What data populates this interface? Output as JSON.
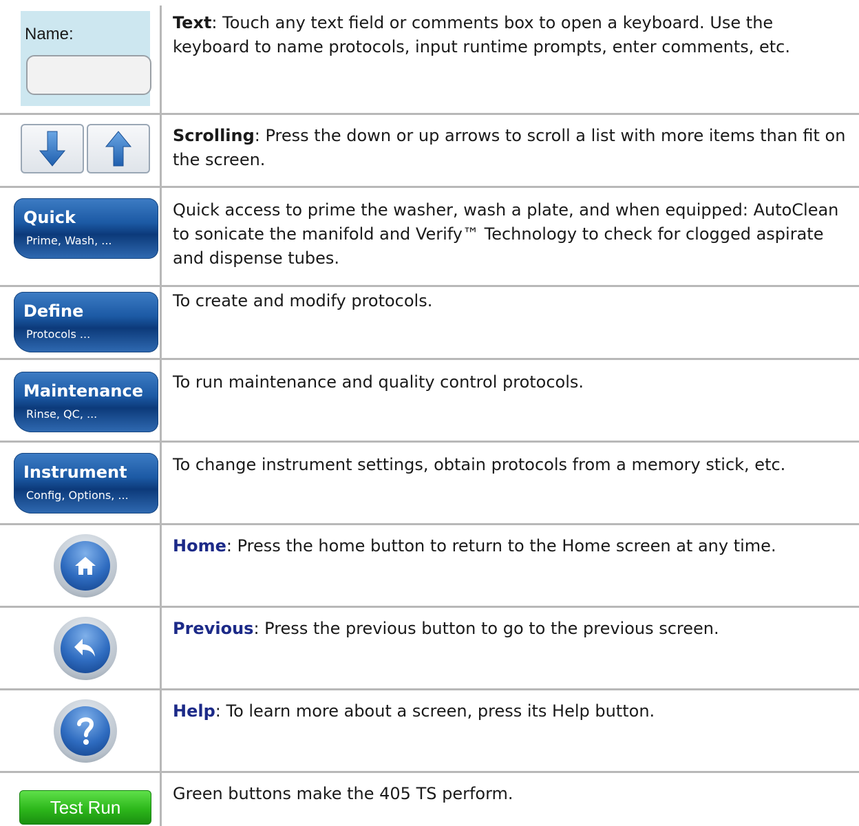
{
  "text_field": {
    "label": "Name:",
    "value": "",
    "term": "Text",
    "description": ": Touch any text field or comments box to open a keyboard. Use the keyboard to name protocols, input runtime prompts, enter comments, etc."
  },
  "scrolling": {
    "term": "Scrolling",
    "description": ": Press the down or up arrows to scroll a list with more items than fit on the screen."
  },
  "quick": {
    "title": "Quick",
    "subtitle": "Prime, Wash, ...",
    "description": "Quick access to prime the washer, wash a plate, and when equipped: AutoClean to sonicate the manifold and Verify™ Technology to check for clogged aspirate and dispense tubes."
  },
  "define": {
    "title": "Define",
    "subtitle": "Protocols ...",
    "description": "To create and modify protocols."
  },
  "maintenance": {
    "title": "Maintenance",
    "subtitle": "Rinse, QC, ...",
    "description": "To run maintenance and quality control protocols."
  },
  "instrument": {
    "title": "Instrument",
    "subtitle": "Config, Options, ...",
    "description": "To change instrument settings, obtain protocols from a memory stick, etc."
  },
  "home": {
    "term": "Home",
    "description": ": Press the home button to return to the Home screen at any time."
  },
  "previous": {
    "term": "Previous",
    "description": ": Press the previous button to go to the previous screen."
  },
  "help": {
    "term": "Help",
    "description": ": To learn more about a screen, press its Help button."
  },
  "test_run": {
    "label": "Test Run",
    "description": "Green buttons make the 405 TS perform."
  },
  "colors": {
    "accent_term": "#1c2a88",
    "menu_blue": "#1c5aa5",
    "test_green": "#2db81b"
  }
}
